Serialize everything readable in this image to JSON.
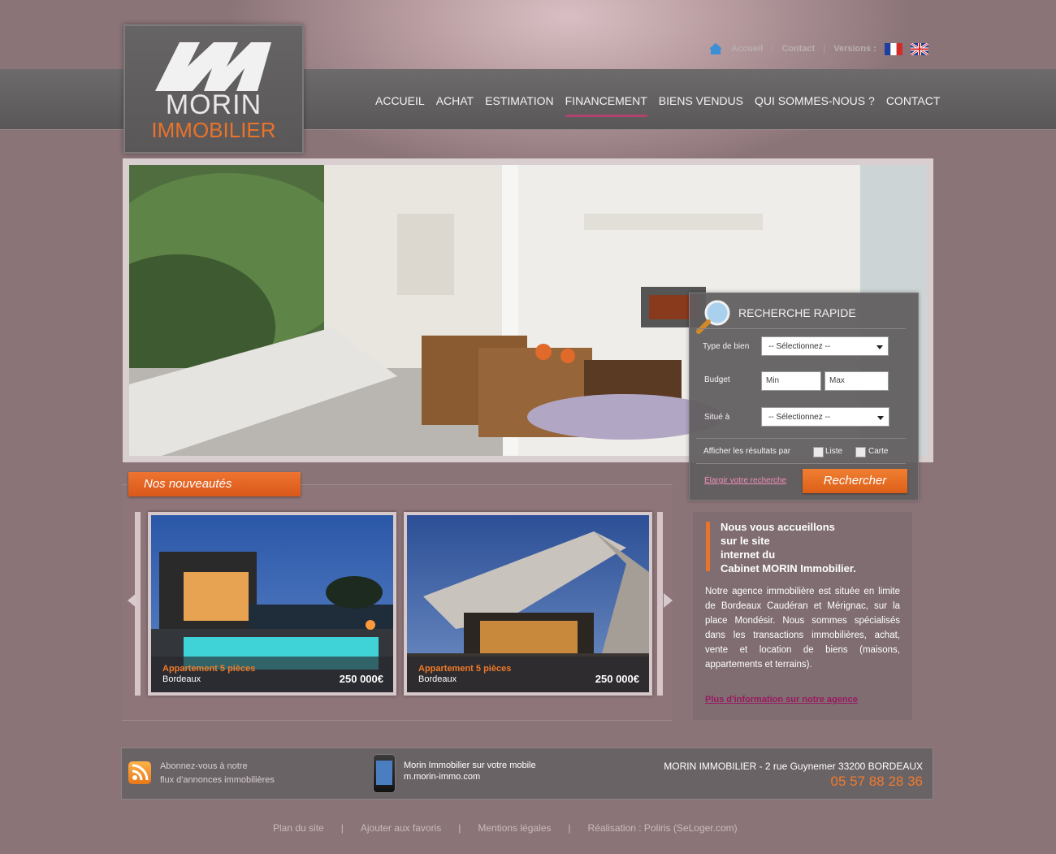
{
  "topbar": {
    "links": [
      "Accueil",
      "Contact"
    ],
    "versions_label": "Versions :"
  },
  "logo": {
    "word1": "MORIN",
    "word2": "IMMOBILIER"
  },
  "nav": {
    "items": [
      "ACCUEIL",
      "ACHAT",
      "ESTIMATION",
      "FINANCEMENT",
      "BIENS VENDUS",
      "QUI SOMMES-NOUS ?",
      "CONTACT"
    ],
    "active": "FINANCEMENT"
  },
  "search": {
    "title": "RECHERCHE RAPIDE",
    "type_label": "Type de bien",
    "type_value": "-- Sélectionnez --",
    "budget_label": "Budget",
    "min_placeholder": "Min",
    "max_placeholder": "Max",
    "location_label": "Situé à",
    "location_value": "-- Sélectionnez --",
    "display_label": "Afficher les résultats par",
    "option_list": "Liste",
    "option_map": "Carte",
    "widen_link": "Élargir votre recherche",
    "submit": "Rechercher"
  },
  "news": {
    "tab": "Nos nouveautés",
    "cards": [
      {
        "title": "Appartement 5 pièces",
        "city": "Bordeaux",
        "price": "250 000€"
      },
      {
        "title": "Appartement 5 pièces",
        "city": "Bordeaux",
        "price": "250 000€"
      }
    ]
  },
  "welcome": {
    "title_lines": [
      "Nous vous accueillons",
      "sur le site",
      "internet du",
      "Cabinet MORIN Immobilier."
    ],
    "body": "Notre agence immobilière est située en limite de Bordeaux Caudéran et Mérignac, sur la place Mondésir. Nous sommes spécialisés dans les transactions immobilières, achat, vente et location de biens (maisons, appartements et terrains).",
    "link": "Plus d'information sur notre agence"
  },
  "footer": {
    "rss_line1": "Abonnez-vous à notre",
    "rss_line2": "flux d'annonces immobilières",
    "mobile_line1": "Morin Immobilier sur votre mobile",
    "mobile_line2": "m.morin-immo.com",
    "address": "MORIN IMMOBILIER - 2 rue Guynemer 33200 BORDEAUX",
    "phone": "05 57 88 28 36"
  },
  "bottom_links": [
    "Plan du site",
    "Ajouter aux favoris",
    "Mentions légales",
    "Réalisation : Poliris (SeLoger.com)"
  ],
  "colors": {
    "accent": "#e8732a",
    "nav_active": "#b0436d",
    "background": "#8b7478"
  }
}
